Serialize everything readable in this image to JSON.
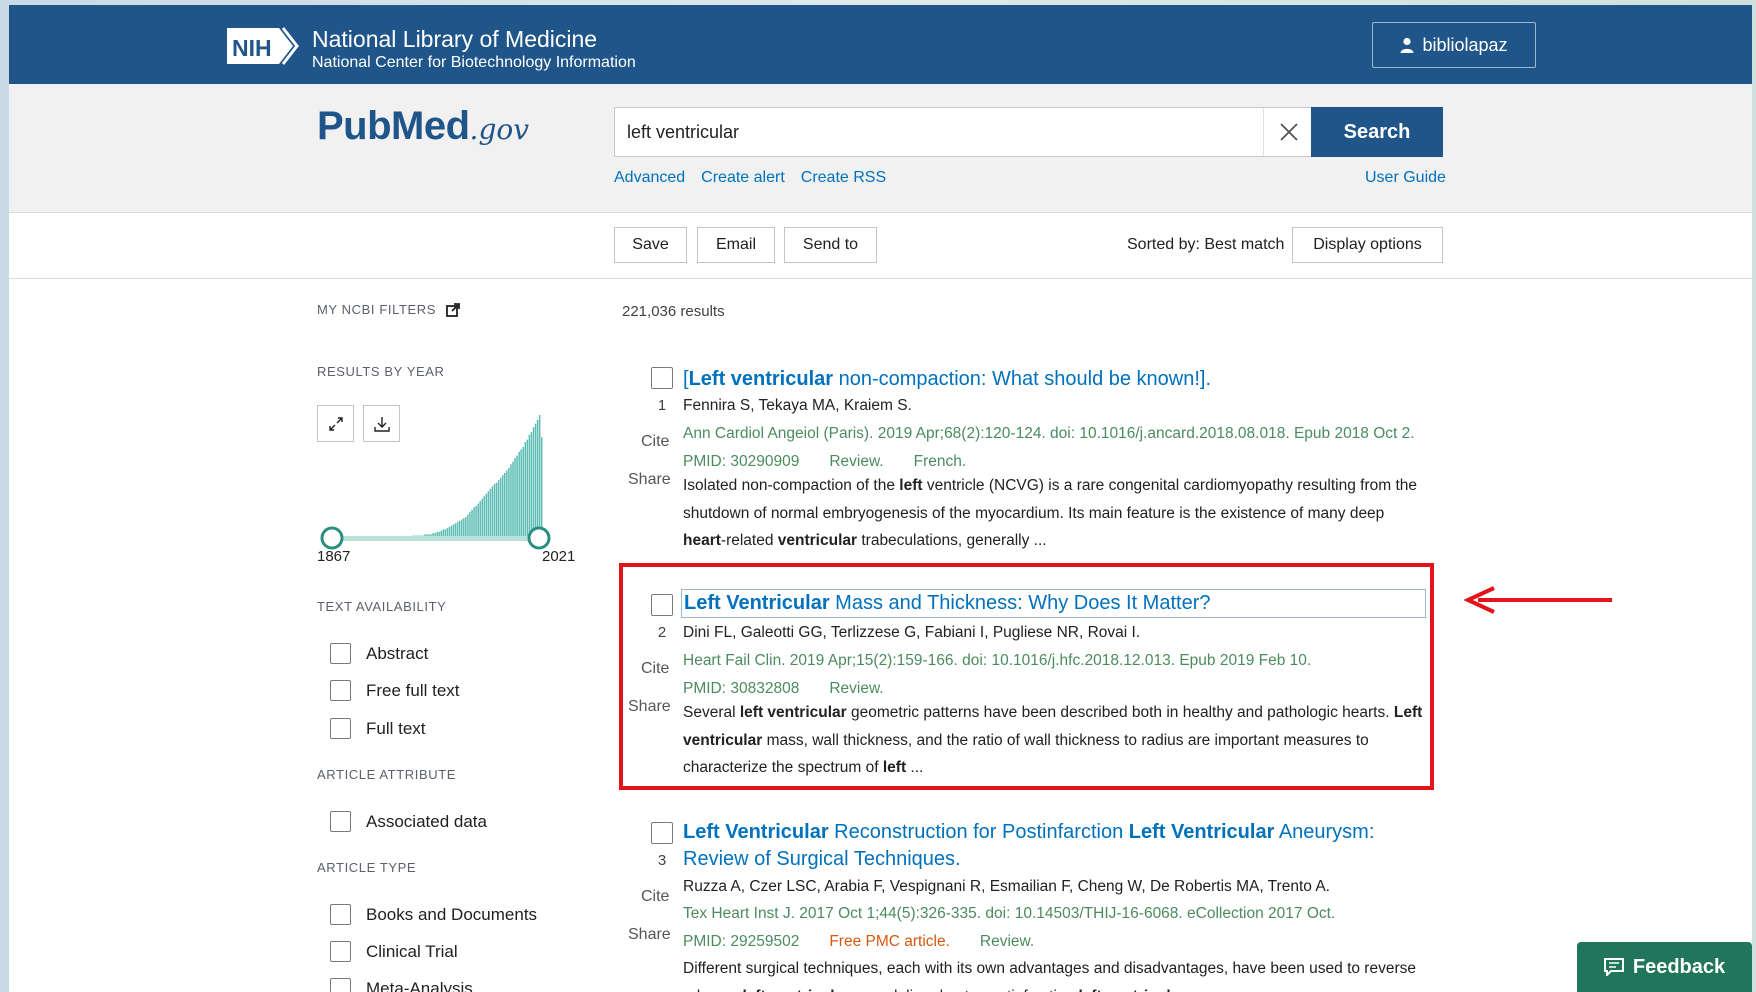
{
  "header": {
    "org_logo": "NIH",
    "title": "National Library of Medicine",
    "subtitle": "National Center for Biotechnology Information",
    "user": "bibliolapaz"
  },
  "search": {
    "logo_pub": "Pub",
    "logo_med": "Med",
    "logo_gov": ".gov",
    "query": "left ventricular",
    "button": "Search",
    "links": [
      "Advanced",
      "Create alert",
      "Create RSS"
    ],
    "user_guide": "User Guide"
  },
  "actions": {
    "save": "Save",
    "email": "Email",
    "send_to": "Send to",
    "sorted_by": "Sorted by: Best match",
    "display_options": "Display options"
  },
  "sidebar": {
    "my_filters": "MY NCBI FILTERS",
    "results_by_year": "RESULTS BY YEAR",
    "year_start": "1867",
    "year_end": "2021",
    "text_availability": "TEXT AVAILABILITY",
    "text_options": [
      "Abstract",
      "Free full text",
      "Full text"
    ],
    "article_attribute": "ARTICLE ATTRIBUTE",
    "attribute_options": [
      "Associated data"
    ],
    "article_type": "ARTICLE TYPE",
    "type_options": [
      "Books and Documents",
      "Clinical Trial",
      "Meta-Analysis"
    ]
  },
  "results": {
    "count": "221,036 results",
    "cite_label": "Cite",
    "share_label": "Share",
    "items": [
      {
        "num": "1",
        "title_pre": "[",
        "title_bold": "Left ventricular",
        "title_rest": " non-compaction: What should be known!].",
        "authors": "Fennira S, Tekaya MA, Kraiem S.",
        "citation": "Ann Cardiol Angeiol (Paris). 2019 Apr;68(2):120-124. doi: 10.1016/j.ancard.2018.08.018. Epub 2018 Oct 2.",
        "pmid": "PMID: 30290909",
        "tag1": "Review.",
        "tag2": "French.",
        "snippet_html": "Isolated non-compaction of the <b>left</b> ventricle (NCVG) is a rare congenital cardiomyopathy resulting from the shutdown of normal embryogenesis of the myocardium. Its main feature is the existence of many deep <b>heart</b>-related <b>ventricular</b> trabeculations, generally ..."
      },
      {
        "num": "2",
        "title_bold": "Left Ventricular",
        "title_rest": " Mass and Thickness: Why Does It Matter?",
        "authors": "Dini FL, Galeotti GG, Terlizzese G, Fabiani I, Pugliese NR, Rovai I.",
        "citation": "Heart Fail Clin. 2019 Apr;15(2):159-166. doi: 10.1016/j.hfc.2018.12.013. Epub 2019 Feb 10.",
        "pmid": "PMID: 30832808",
        "tag1": "Review.",
        "snippet_html": "Several <b>left ventricular</b> geometric patterns have been described both in healthy and pathologic hearts. <b>Left ventricular</b> mass, wall thickness, and the ratio of wall thickness to radius are important measures to characterize the spectrum of <b>left</b> ..."
      },
      {
        "num": "3",
        "title_html": "<b>Left Ventricular</b> Reconstruction for Postinfarction <b>Left Ventricular</b> Aneurysm: Review of Surgical Techniques.",
        "authors": "Ruzza A, Czer LSC, Arabia F, Vespignani R, Esmailian F, Cheng W, De Robertis MA, Trento A.",
        "citation": "Tex Heart Inst J. 2017 Oct 1;44(5):326-335. doi: 10.14503/THIJ-16-6068. eCollection 2017 Oct.",
        "pmid": "PMID: 29259502",
        "free": "Free PMC article.",
        "tag1": "Review.",
        "snippet_html": "Different surgical techniques, each with its own advantages and disadvantages, have been used to reverse adverse <b>left ventricular</b> remodeling due to postinfarction <b>left ventricular</b> aneurysm. ..."
      }
    ]
  },
  "feedback": "Feedback",
  "chart_data": {
    "type": "bar",
    "x_range": [
      1867,
      2021
    ],
    "note_values_relative": [
      1,
      1,
      1,
      1,
      1,
      1,
      1,
      1,
      1,
      1,
      1,
      1,
      1,
      1,
      1,
      1,
      1,
      1,
      2,
      2,
      2,
      2,
      2,
      2,
      3,
      3,
      3,
      3,
      4,
      4,
      5,
      5,
      6,
      7,
      7,
      8,
      9,
      10,
      11,
      12,
      13,
      14,
      15,
      16,
      17,
      19,
      21,
      23,
      25,
      26,
      28,
      30,
      32,
      34,
      36,
      38,
      40,
      42,
      44,
      45,
      47,
      49,
      51,
      53,
      55,
      57,
      60,
      62,
      65,
      67,
      70,
      72,
      74,
      78,
      80,
      84,
      86,
      90,
      93,
      96,
      100,
      82
    ]
  },
  "colors": {
    "nih_blue": "#20558a",
    "link_blue": "#0071bc",
    "citation_green": "#4b8b5e",
    "histogram_teal": "#5bbcb3",
    "annotation_red": "#e1141c"
  }
}
